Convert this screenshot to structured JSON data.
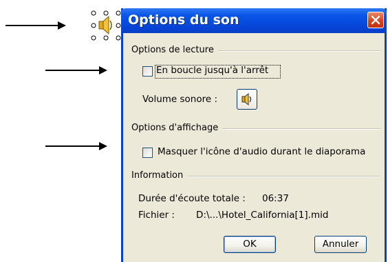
{
  "dialog": {
    "title": "Options du son"
  },
  "playback": {
    "group_label": "Options de lecture",
    "loop_label": "En boucle jusqu'à l'arrêt",
    "loop_checked": false,
    "volume_label": "Volume sonore :"
  },
  "display": {
    "group_label": "Options d'affichage",
    "hide_icon_label": "Masquer l'icône d'audio durant le diaporama",
    "hide_icon_checked": false
  },
  "information": {
    "group_label": "Information",
    "duration_label": "Durée d'écoute totale :",
    "duration_value": "06:37",
    "file_label": "Fichier :",
    "file_value": "D:\\...\\Hotel_California[1].mid"
  },
  "buttons": {
    "ok": "OK",
    "cancel": "Annuler"
  },
  "colors": {
    "titlebar": "#0a55e6",
    "dialog_bg": "#ece9d8",
    "close": "#d8431f"
  },
  "icons": {
    "slide_object": "speaker-icon",
    "volume": "speaker-icon",
    "close": "close-icon"
  }
}
